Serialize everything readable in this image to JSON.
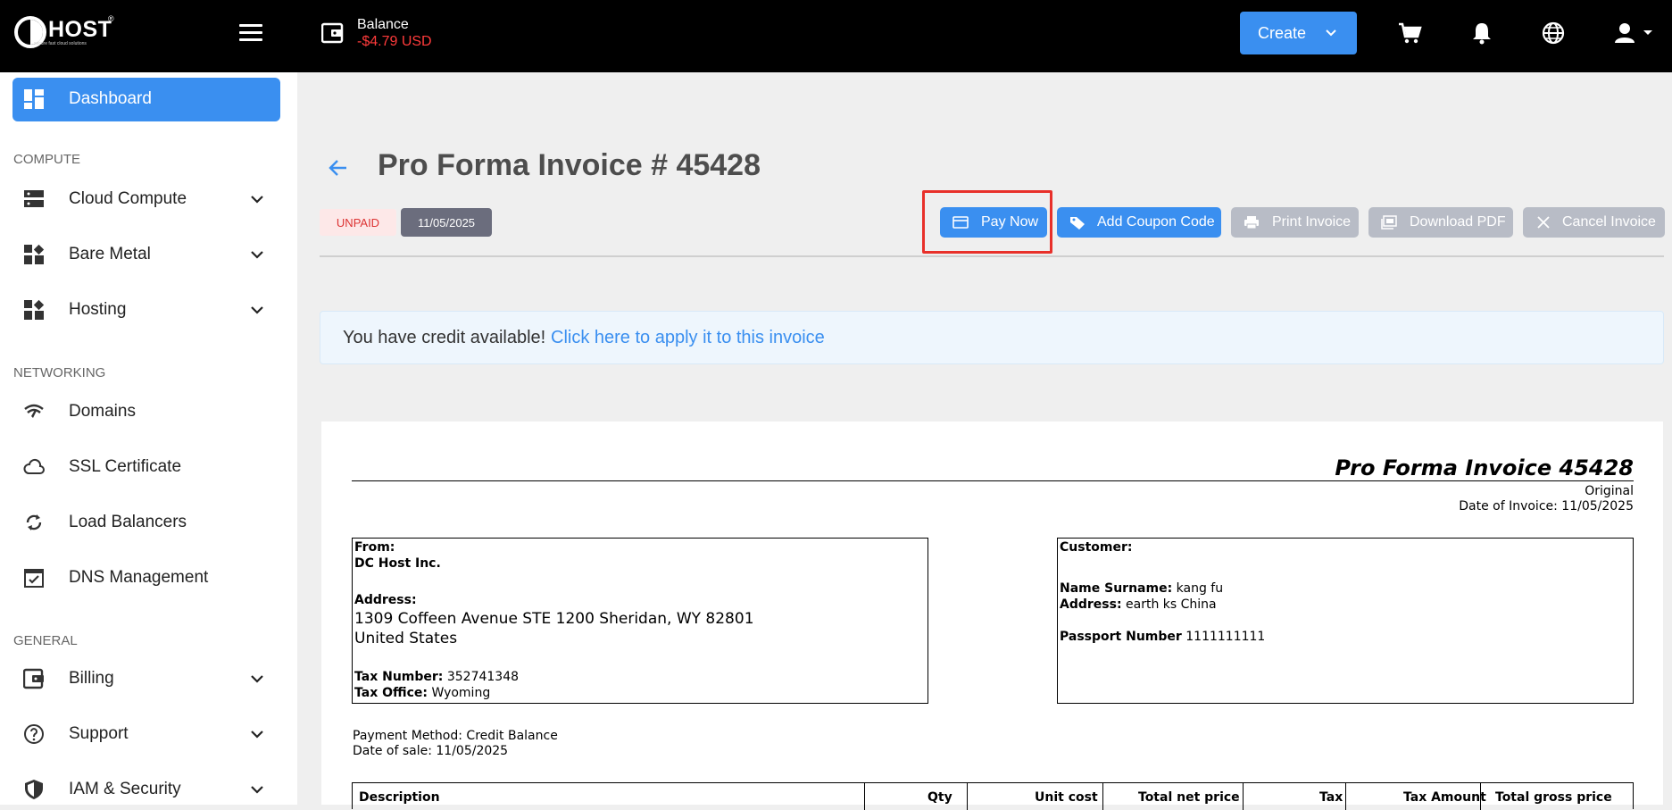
{
  "header": {
    "logo_text": "HOST",
    "logo_reg": "®",
    "logo_tagline": "secure fast cloud solutions",
    "balance_label": "Balance",
    "balance_value": "-$4.79 USD",
    "create_label": "Create"
  },
  "sidebar": {
    "dashboard_label": "Dashboard",
    "sections": {
      "compute": "COMPUTE",
      "networking": "NETWORKING",
      "general": "GENERAL"
    },
    "items": [
      {
        "label": "Cloud Compute",
        "icon": "server-icon"
      },
      {
        "label": "Bare Metal",
        "icon": "blocks-icon"
      },
      {
        "label": "Hosting",
        "icon": "blocks-icon"
      },
      {
        "label": "Domains",
        "icon": "wifi-icon"
      },
      {
        "label": "SSL Certificate",
        "icon": "cloud-icon"
      },
      {
        "label": "Load Balancers",
        "icon": "sync-icon"
      },
      {
        "label": "DNS Management",
        "icon": "calendar-check-icon"
      },
      {
        "label": "Billing",
        "icon": "wallet-icon"
      },
      {
        "label": "Support",
        "icon": "help-icon"
      },
      {
        "label": "IAM & Security",
        "icon": "shield-icon"
      }
    ]
  },
  "page": {
    "title": "Pro Forma Invoice # 45428",
    "status": "UNPAID",
    "date": "11/05/2025",
    "actions": {
      "pay_now": "Pay Now",
      "add_coupon": "Add Coupon Code",
      "print": "Print Invoice",
      "download_pdf": "Download PDF",
      "cancel": "Cancel Invoice"
    },
    "credit_text": "You have credit available!",
    "credit_link": "Click here to apply it to this invoice"
  },
  "invoice": {
    "title": "Pro Forma Invoice 45428",
    "copy": "Original",
    "date_of_invoice": "Date of Invoice: 11/05/2025",
    "from": {
      "heading": "From:",
      "company": "DC Host Inc.",
      "address_label": "Address:",
      "address_line1": "1309 Coffeen Avenue STE 1200 Sheridan, WY 82801",
      "address_line2": "United States",
      "tax_number_label": "Tax Number:",
      "tax_number": "352741348",
      "tax_office_label": "Tax Office:",
      "tax_office": "Wyoming"
    },
    "customer": {
      "heading": "Customer:",
      "name_label": "Name Surname:",
      "name": "kang fu",
      "address_label": "Address:",
      "address": "earth ks China",
      "passport_label": "Passport Number",
      "passport": "1111111111"
    },
    "payment_method": "Payment Method: Credit Balance",
    "date_of_sale": "Date of sale: 11/05/2025",
    "columns": [
      "Description",
      "Qty",
      "Unit cost",
      "Total net price",
      "Tax",
      "Tax Amount",
      "Total gross price"
    ]
  },
  "colors": {
    "accent": "#3a8ff0",
    "topbar": "#000000",
    "balance_negative": "#ff3b3b",
    "highlight": "#e8302a",
    "gray_button": "#b8bcc6"
  }
}
